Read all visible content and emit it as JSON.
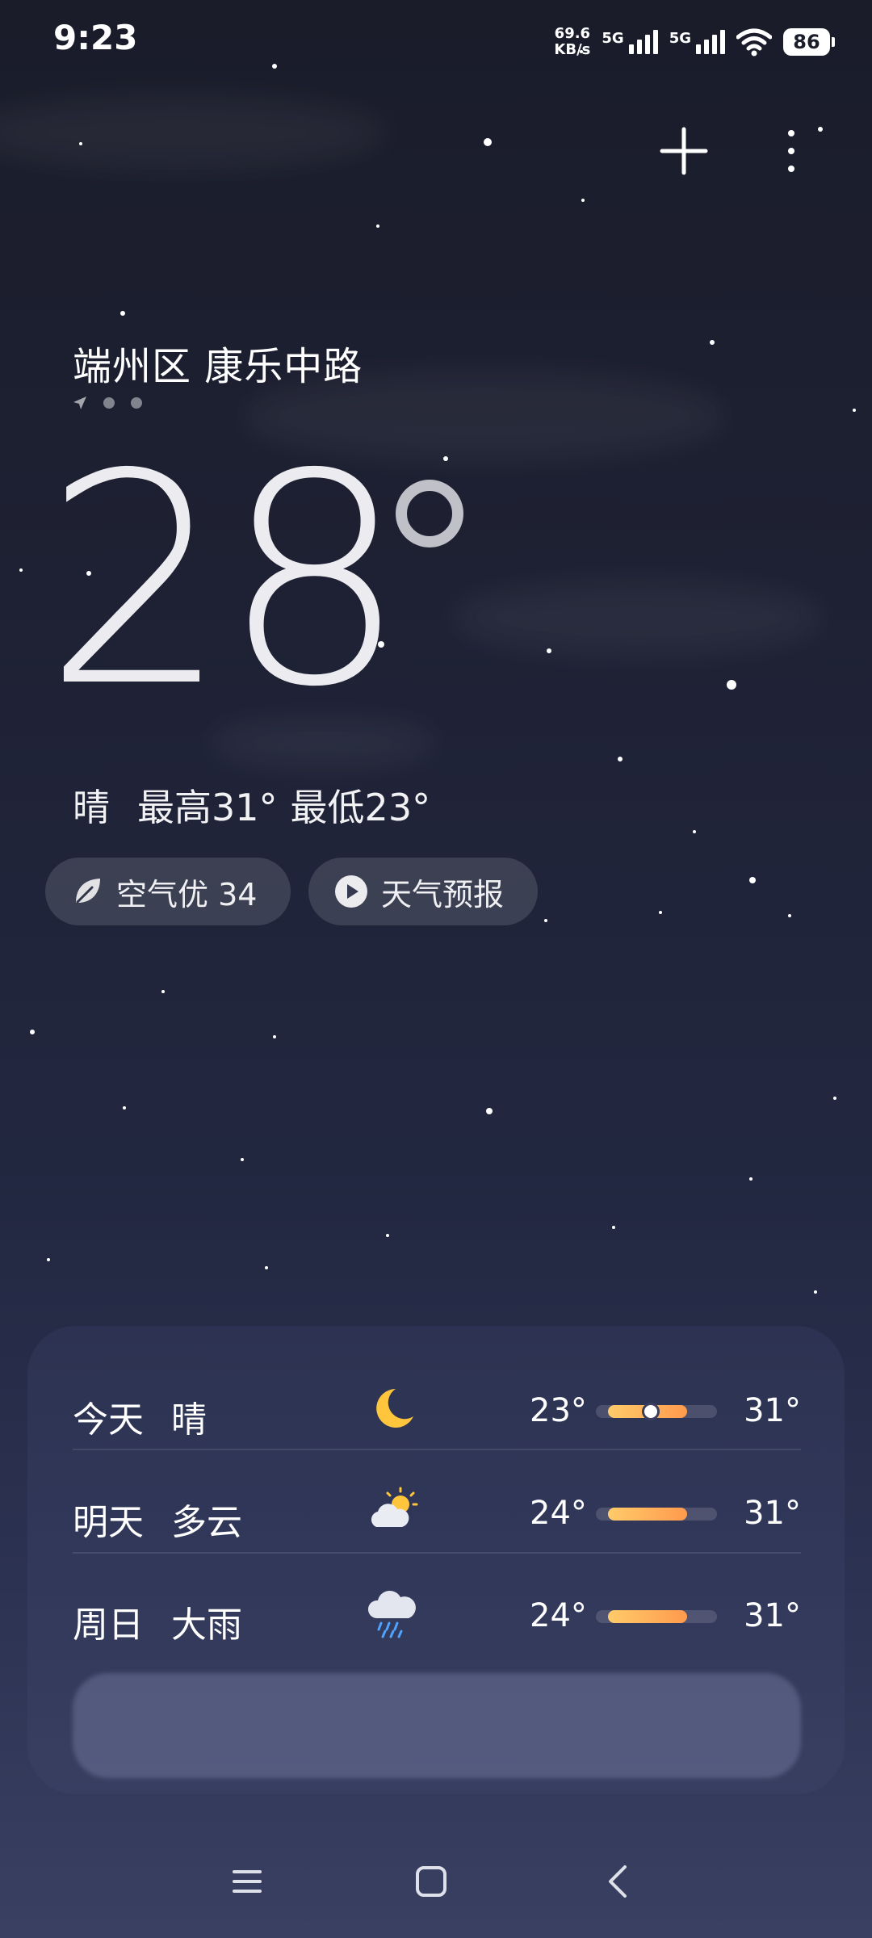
{
  "status_bar": {
    "time": "9:23",
    "net_speed_value": "69.6",
    "net_speed_unit": "KB/s",
    "sim1_label": "5G",
    "sim2_label": "5G",
    "battery": "86"
  },
  "location": {
    "name": "端州区 康乐中路",
    "page_count": 3,
    "active_page": 1
  },
  "current": {
    "temperature": "28",
    "condition": "晴",
    "high": "最高31°",
    "low": "最低23°"
  },
  "chips": {
    "air_quality": "空气优 34",
    "forecast_video": "天气预报"
  },
  "forecast": [
    {
      "day": "今天",
      "condition": "晴",
      "icon": "moon-icon",
      "low": "23°",
      "high": "31°",
      "range_start": 0.1,
      "range_end": 0.75,
      "current_pos": 0.45
    },
    {
      "day": "明天",
      "condition": "多云",
      "icon": "partly-cloudy-icon",
      "low": "24°",
      "high": "31°",
      "range_start": 0.1,
      "range_end": 0.75
    },
    {
      "day": "周日",
      "condition": "大雨",
      "icon": "heavy-rain-icon",
      "low": "24°",
      "high": "31°",
      "range_start": 0.1,
      "range_end": 0.75
    }
  ],
  "colors": {
    "bar_fill_start": "#ffcb6a",
    "bar_fill_end": "#ff9a4d",
    "moon": "#ffc53d"
  }
}
